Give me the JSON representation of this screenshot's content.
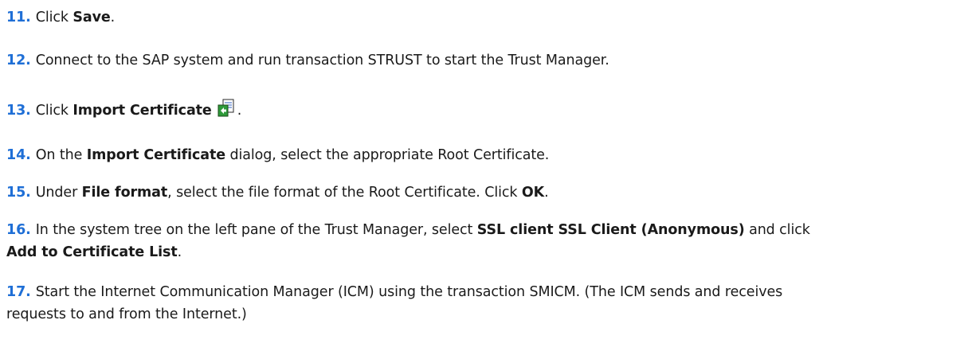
{
  "steps": [
    {
      "num": "11.",
      "parts": [
        "Click ",
        "Save",
        "."
      ]
    },
    {
      "num": "12.",
      "text": "Connect to the SAP system and run transaction STRUST to start the Trust Manager."
    },
    {
      "num": "13.",
      "parts": [
        "Click ",
        "Import Certificate",
        "."
      ],
      "icon": "import-certificate-icon"
    },
    {
      "num": "14.",
      "parts": [
        "On the ",
        "Import Certificate",
        " dialog, select the appropriate Root Certificate."
      ]
    },
    {
      "num": "15.",
      "parts": [
        "Under ",
        "File format",
        ", select the file format of the Root Certificate. Click ",
        "OK",
        "."
      ]
    },
    {
      "num": "16.",
      "line1": [
        "In the system tree on the left pane of the Trust Manager, select ",
        "SSL client SSL Client (Anonymous)",
        " and click"
      ],
      "line2": [
        "Add to Certificate List",
        "."
      ]
    },
    {
      "num": "17.",
      "line1": "Start the Internet Communication Manager (ICM) using the transaction SMICM. (The ICM sends and receives",
      "line2": "requests to and from the Internet.)"
    }
  ],
  "colors": {
    "step_number": "#1f6fd6",
    "text": "#1a1a1a"
  }
}
